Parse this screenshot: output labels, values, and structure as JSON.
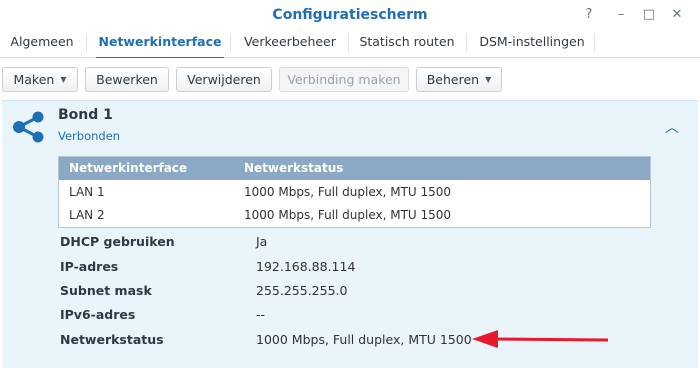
{
  "window": {
    "title": "Configuratiescherm",
    "controls": [
      "?",
      "–",
      "□",
      "✕"
    ]
  },
  "tabs": [
    {
      "label": "Algemeen",
      "active": false
    },
    {
      "label": "Netwerkinterface",
      "active": true
    },
    {
      "label": "Verkeerbeheer",
      "active": false
    },
    {
      "label": "Statisch routen",
      "active": false
    },
    {
      "label": "DSM-instellingen",
      "active": false
    }
  ],
  "toolbar": {
    "create_label": "Maken",
    "edit_label": "Bewerken",
    "delete_label": "Verwijderen",
    "connect_label": "Verbinding maken",
    "manage_label": "Beheren"
  },
  "bond": {
    "icon": "share-icon",
    "name": "Bond 1",
    "status": "Verbonden",
    "table": {
      "headers": [
        "Netwerkinterface",
        "Netwerkstatus"
      ],
      "rows": [
        [
          "LAN 1",
          "1000 Mbps, Full duplex, MTU 1500"
        ],
        [
          "LAN 2",
          "1000 Mbps, Full duplex, MTU 1500"
        ]
      ]
    },
    "properties": [
      {
        "label": "DHCP gebruiken",
        "value": "Ja"
      },
      {
        "label": "IP-adres",
        "value": "192.168.88.114"
      },
      {
        "label": "Subnet mask",
        "value": "255.255.255.0"
      },
      {
        "label": "IPv6-adres",
        "value": "--"
      },
      {
        "label": "Netwerkstatus",
        "value": "1000 Mbps, Full duplex, MTU 1500"
      }
    ]
  },
  "colors": {
    "accent": "#1e6fb6",
    "panel_bg": "#eaf4fb",
    "table_header": "#8ba8c5",
    "annotation_arrow": "#e8192c"
  }
}
